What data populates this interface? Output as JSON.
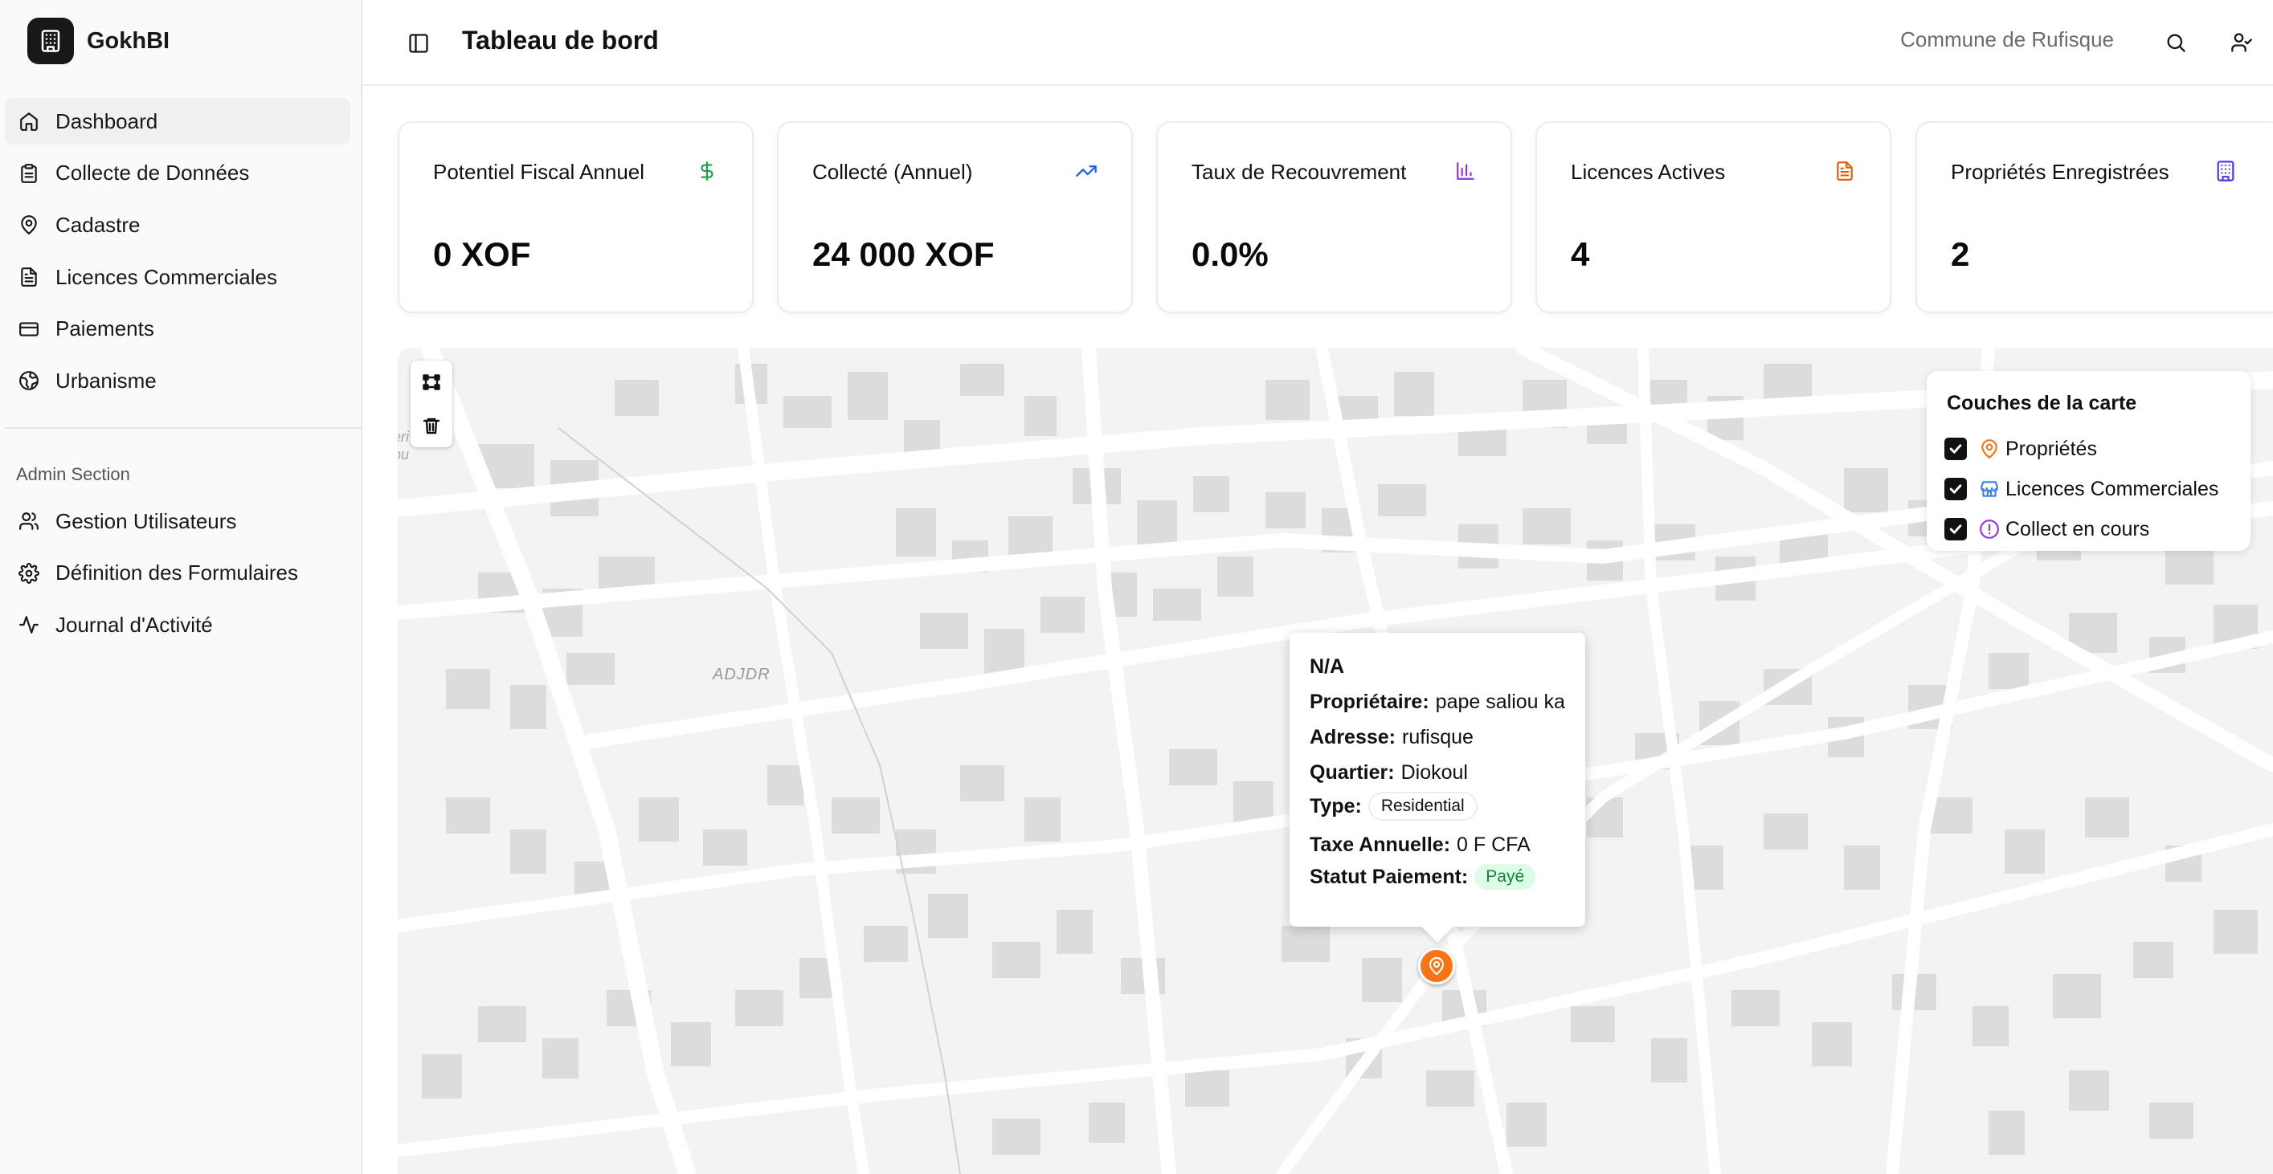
{
  "app": {
    "name": "GokhBI"
  },
  "sidebar": {
    "items": [
      {
        "label": "Dashboard",
        "icon": "home-icon",
        "active": true
      },
      {
        "label": "Collecte de Données",
        "icon": "clipboard-icon"
      },
      {
        "label": "Cadastre",
        "icon": "map-pin-icon"
      },
      {
        "label": "Licences Commerciales",
        "icon": "file-text-icon"
      },
      {
        "label": "Paiements",
        "icon": "credit-card-icon"
      },
      {
        "label": "Urbanisme",
        "icon": "globe-icon"
      }
    ],
    "admin_title": "Admin Section",
    "admin_items": [
      {
        "label": "Gestion Utilisateurs",
        "icon": "users-icon"
      },
      {
        "label": "Définition des Formulaires",
        "icon": "gear-icon"
      },
      {
        "label": "Journal d'Activité",
        "icon": "activity-icon"
      }
    ]
  },
  "header": {
    "title": "Tableau de bord",
    "commune": "Commune de Rufisque"
  },
  "stats": [
    {
      "title": "Potentiel Fiscal Annuel",
      "value": "0 XOF",
      "icon": "dollar-icon",
      "color": "#16a34a"
    },
    {
      "title": "Collecté (Annuel)",
      "value": "24 000 XOF",
      "icon": "trending-up-icon",
      "color": "#2563eb"
    },
    {
      "title": "Taux de Recouvrement",
      "value": "0.0%",
      "icon": "bar-chart-icon",
      "color": "#9333ea"
    },
    {
      "title": "Licences Actives",
      "value": "4",
      "icon": "file-text-icon",
      "color": "#ea580c"
    },
    {
      "title": "Propriétés Enregistrées",
      "value": "2",
      "icon": "building-icon",
      "color": "#4f46e5"
    }
  ],
  "map": {
    "place_label": "ADJDR",
    "place_fragment_1": "eri",
    "place_fragment_2": "ou",
    "layers": {
      "title": "Couches de la carte",
      "items": [
        {
          "label": "Propriétés",
          "checked": true,
          "icon": "map-pin-icon",
          "color": "#f97316"
        },
        {
          "label": "Licences Commerciales",
          "checked": true,
          "icon": "store-icon",
          "color": "#3b82f6"
        },
        {
          "label": "Collect en cours",
          "checked": true,
          "icon": "alert-circle-icon",
          "color": "#9333ea"
        }
      ]
    },
    "popup": {
      "title": "N/A",
      "owner_label": "Propriétaire:",
      "owner": "pape saliou ka",
      "address_label": "Adresse:",
      "address": "rufisque",
      "district_label": "Quartier:",
      "district": "Diokoul",
      "type_label": "Type:",
      "type": "Residential",
      "tax_label": "Taxe Annuelle:",
      "tax": "0 F CFA",
      "status_label": "Statut Paiement:",
      "status": "Payé"
    }
  }
}
